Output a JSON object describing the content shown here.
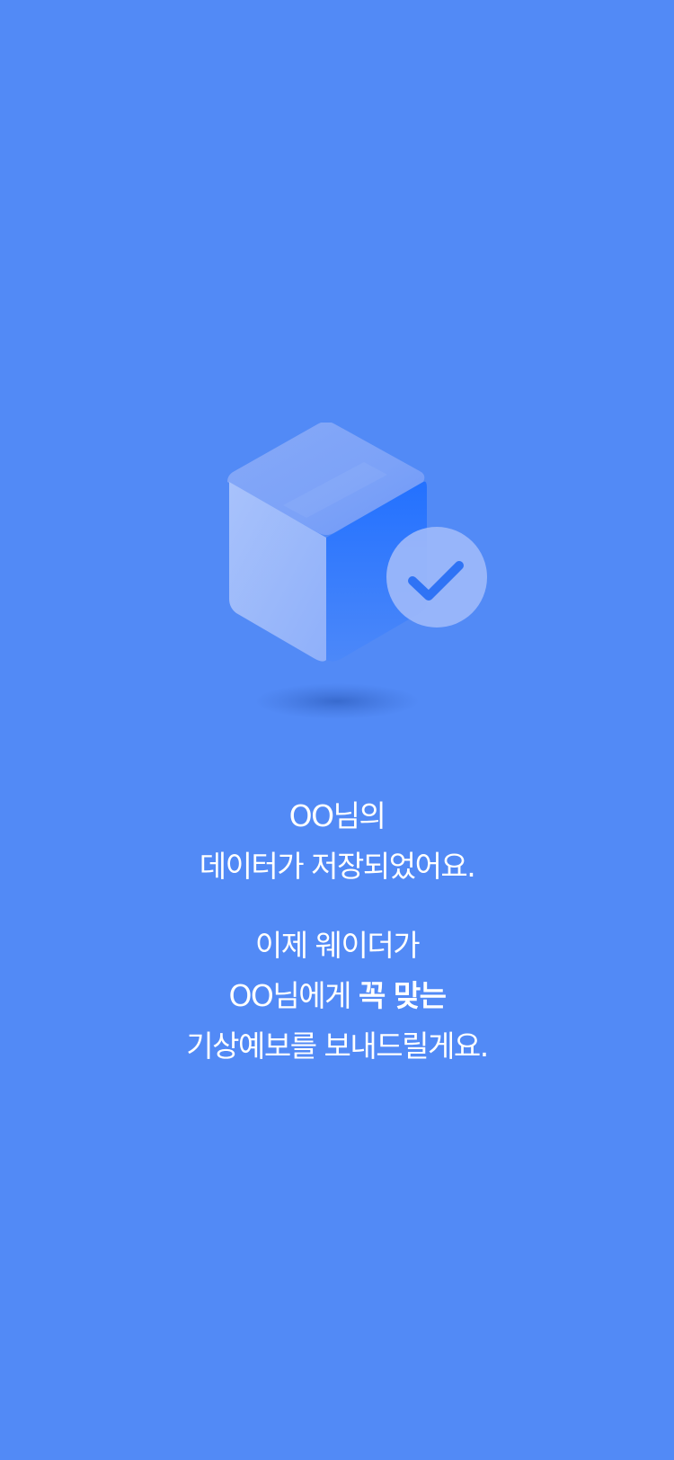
{
  "colors": {
    "background": "#528AF6",
    "text": "#FFFFFF",
    "accent": "#2473FF"
  },
  "illustration": {
    "icon": "saved-box-check-icon"
  },
  "saved_message": {
    "line1": "OO님의",
    "line2": "데이터가 저장되었어요."
  },
  "forecast_message": {
    "line1": "이제 웨이더가",
    "line2_normal": "OO님에게 ",
    "line2_bold": "꼭 맞는",
    "line3_bold": "기상예보를 보내드릴게요."
  }
}
